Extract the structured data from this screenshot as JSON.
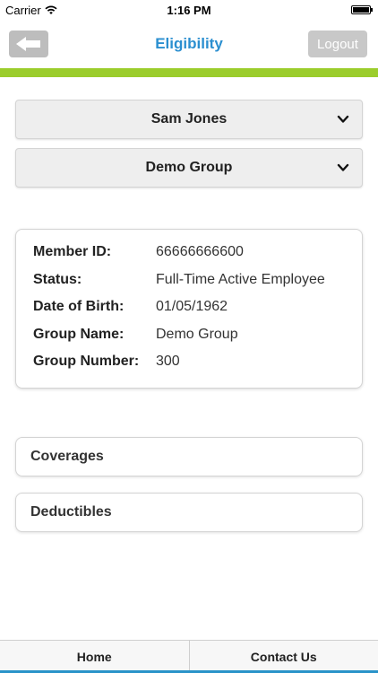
{
  "status_bar": {
    "carrier": "Carrier",
    "time": "1:16 PM"
  },
  "nav": {
    "title": "Eligibility",
    "back_icon": "back-arrow-icon",
    "logout_label": "Logout"
  },
  "colors": {
    "title_blue": "#2b8fd0",
    "accent_green": "#9bcd2c",
    "tab_underline": "#2a93c9"
  },
  "selectors": {
    "member": "Sam Jones",
    "group": "Demo Group"
  },
  "member_info": {
    "rows": [
      {
        "label": "Member ID:",
        "value": "66666666600"
      },
      {
        "label": "Status:",
        "value": "Full-Time Active Employee"
      },
      {
        "label": "Date of Birth:",
        "value": "01/05/1962"
      },
      {
        "label": "Group Name:",
        "value": "Demo Group"
      },
      {
        "label": "Group Number:",
        "value": "300"
      }
    ]
  },
  "sections": {
    "coverages": "Coverages",
    "deductibles": "Deductibles"
  },
  "tabs": {
    "home": "Home",
    "contact": "Contact Us"
  }
}
